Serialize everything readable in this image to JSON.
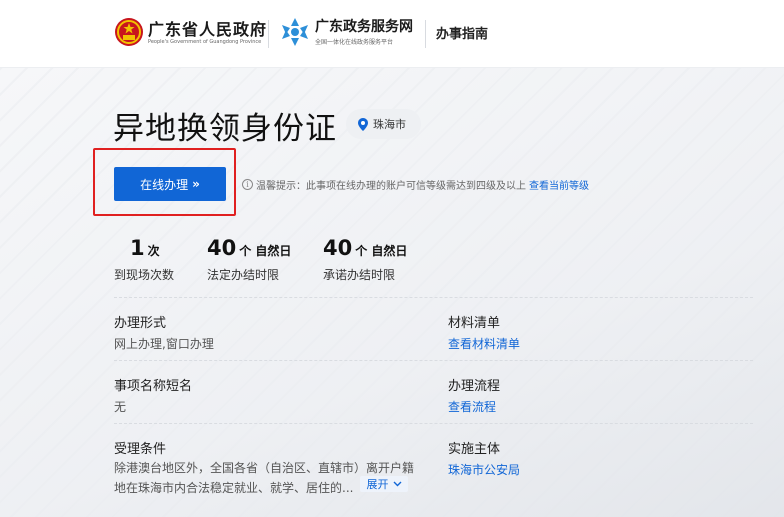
{
  "header": {
    "gov_name": "广东省人民政府",
    "gov_subtitle": "People's Government of Guangdong Province",
    "portal_name": "广东政务服务网",
    "portal_subtitle": "全国一体化在线政务服务平台",
    "section": "办事指南"
  },
  "page": {
    "title": "异地换领身份证",
    "location": "珠海市",
    "online_button": "在线办理",
    "online_button_arrows": "»",
    "tip_icon": "i",
    "tip_text": "温馨提示：此事项在线办理的账户可信等级需达到四级及以上",
    "tip_link": "查看当前等级"
  },
  "stats": [
    {
      "value": "1",
      "unit": "次",
      "label": "到现场次数"
    },
    {
      "value": "40",
      "unit": "个 自然日",
      "label": "法定办结时限"
    },
    {
      "value": "40",
      "unit": "个 自然日",
      "label": "承诺办结时限"
    }
  ],
  "fields": {
    "mode_label": "办理形式",
    "mode_value": "网上办理,窗口办理",
    "materials_label": "材料清单",
    "materials_link": "查看材料清单",
    "short_name_label": "事项名称短名",
    "short_name_value": "无",
    "process_label": "办理流程",
    "process_link": "查看流程",
    "condition_label": "受理条件",
    "condition_line1": "除港澳台地区外，全国各省（自治区、直辖市）离开户籍",
    "condition_line2": "地在珠海市内合法稳定就业、就学、居住的...",
    "expand_label": "展开",
    "expand_icon": "chevron-down-icon",
    "authority_label": "实施主体",
    "authority_link": "珠海市公安局"
  },
  "colors": {
    "accent": "#1166d6",
    "highlight": "#e02020"
  }
}
